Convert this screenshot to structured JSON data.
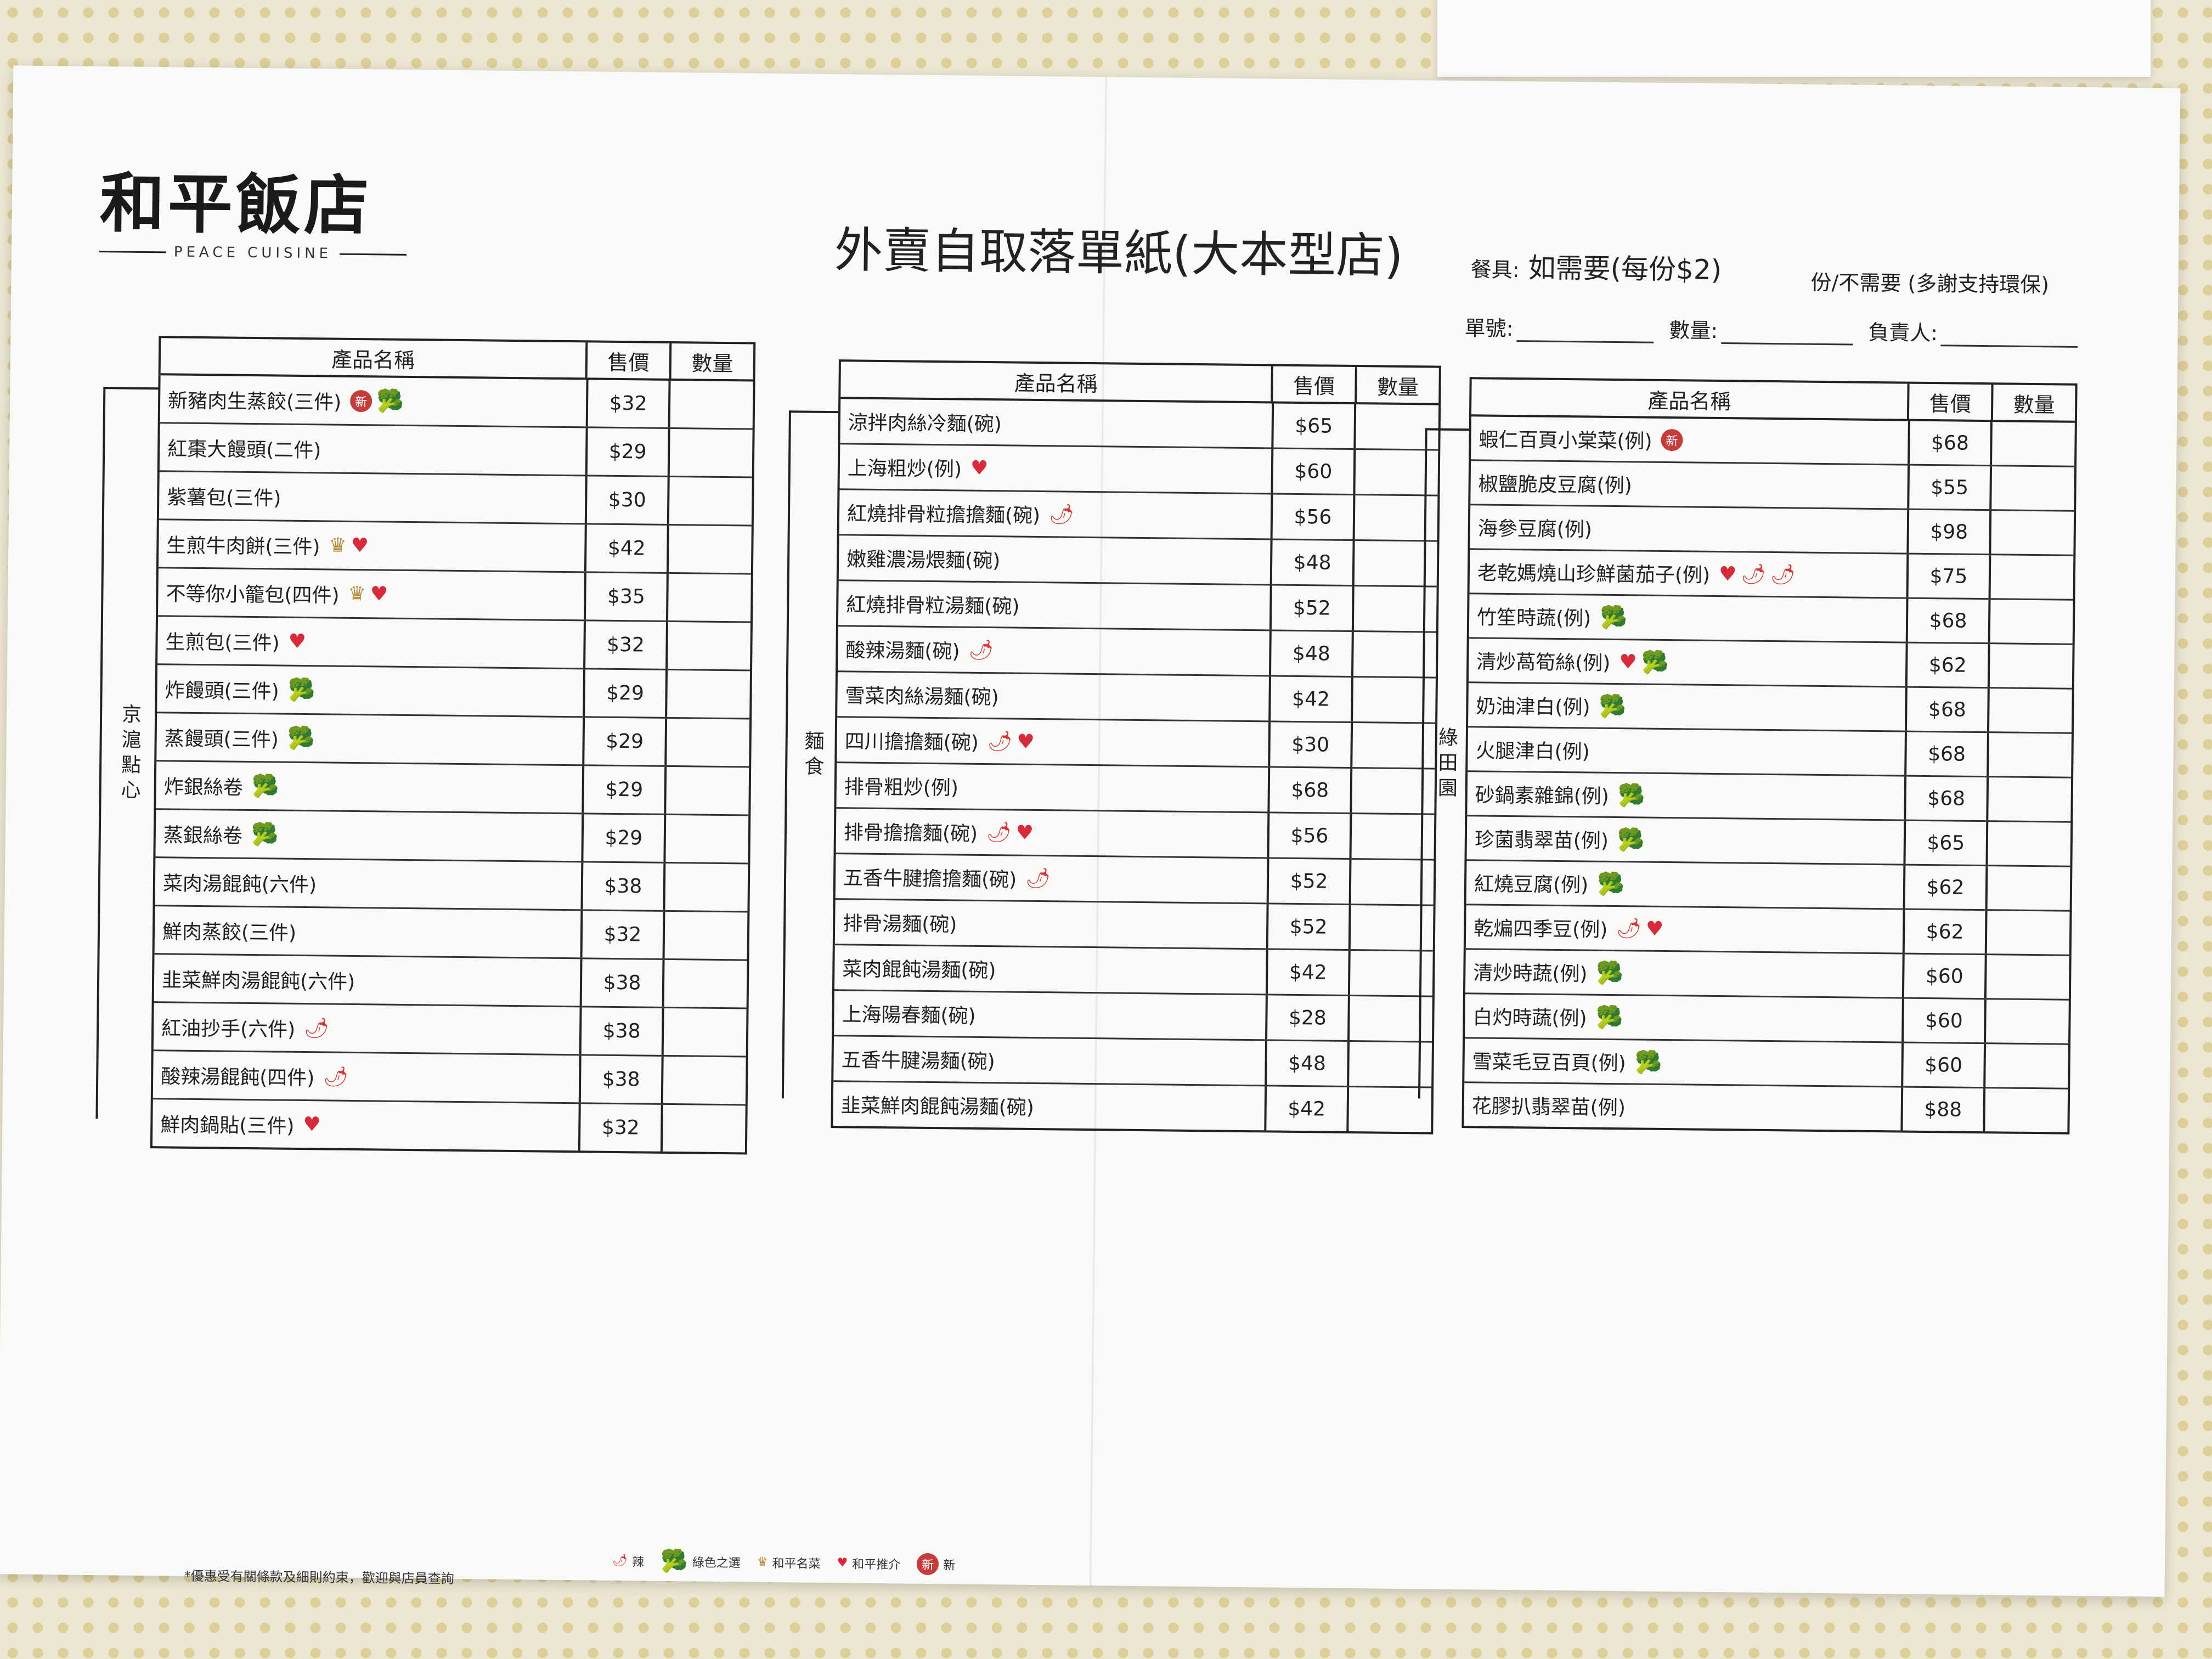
{
  "brand": {
    "name": "和平飯店",
    "sub": "PEACE CUISINE"
  },
  "title": "外賣自取落單紙(大本型店)",
  "utensil": {
    "label": "餐具:",
    "need": "如需要(每份$2)",
    "noneed": "份/不需要 (多謝支持環保)"
  },
  "fields": {
    "order_no": "單號:",
    "qty": "數量:",
    "person": "負責人:"
  },
  "headers": {
    "name": "產品名稱",
    "price": "售價",
    "qty": "數量"
  },
  "sections": [
    {
      "label": "京滬點心",
      "items": [
        {
          "name": "新豬肉生蒸餃(三件)",
          "price": "$32",
          "icons": [
            "new",
            "veg"
          ]
        },
        {
          "name": "紅棗大饅頭(二件)",
          "price": "$29",
          "icons": []
        },
        {
          "name": "紫薯包(三件)",
          "price": "$30",
          "icons": []
        },
        {
          "name": "生煎牛肉餅(三件)",
          "price": "$42",
          "icons": [
            "crown",
            "heart"
          ]
        },
        {
          "name": "不等你小籠包(四件)",
          "price": "$35",
          "icons": [
            "crown",
            "heart"
          ]
        },
        {
          "name": "生煎包(三件)",
          "price": "$32",
          "icons": [
            "heart"
          ]
        },
        {
          "name": "炸饅頭(三件)",
          "price": "$29",
          "icons": [
            "veg"
          ]
        },
        {
          "name": "蒸饅頭(三件)",
          "price": "$29",
          "icons": [
            "veg"
          ]
        },
        {
          "name": "炸銀絲卷",
          "price": "$29",
          "icons": [
            "veg"
          ]
        },
        {
          "name": "蒸銀絲卷",
          "price": "$29",
          "icons": [
            "veg"
          ]
        },
        {
          "name": "菜肉湯餛飩(六件)",
          "price": "$38",
          "icons": []
        },
        {
          "name": "鮮肉蒸餃(三件)",
          "price": "$32",
          "icons": []
        },
        {
          "name": "韭菜鮮肉湯餛飩(六件)",
          "price": "$38",
          "icons": []
        },
        {
          "name": "紅油抄手(六件)",
          "price": "$38",
          "icons": [
            "chili"
          ]
        },
        {
          "name": "酸辣湯餛飩(四件)",
          "price": "$38",
          "icons": [
            "chili"
          ]
        },
        {
          "name": "鮮肉鍋貼(三件)",
          "price": "$32",
          "icons": [
            "heart"
          ]
        }
      ]
    },
    {
      "label": "麵食",
      "items": [
        {
          "name": "涼拌肉絲冷麵(碗)",
          "price": "$65",
          "icons": []
        },
        {
          "name": "上海粗炒(例)",
          "price": "$60",
          "icons": [
            "heart"
          ]
        },
        {
          "name": "紅燒排骨粒擔擔麵(碗)",
          "price": "$56",
          "icons": [
            "chili"
          ]
        },
        {
          "name": "嫩雞濃湯煨麵(碗)",
          "price": "$48",
          "icons": []
        },
        {
          "name": "紅燒排骨粒湯麵(碗)",
          "price": "$52",
          "icons": []
        },
        {
          "name": "酸辣湯麵(碗)",
          "price": "$48",
          "icons": [
            "chili"
          ]
        },
        {
          "name": "雪菜肉絲湯麵(碗)",
          "price": "$42",
          "icons": []
        },
        {
          "name": "四川擔擔麵(碗)",
          "price": "$30",
          "icons": [
            "chili",
            "heart"
          ]
        },
        {
          "name": "排骨粗炒(例)",
          "price": "$68",
          "icons": []
        },
        {
          "name": "排骨擔擔麵(碗)",
          "price": "$56",
          "icons": [
            "chili",
            "heart"
          ]
        },
        {
          "name": "五香牛腱擔擔麵(碗)",
          "price": "$52",
          "icons": [
            "chili"
          ]
        },
        {
          "name": "排骨湯麵(碗)",
          "price": "$52",
          "icons": []
        },
        {
          "name": "菜肉餛飩湯麵(碗)",
          "price": "$42",
          "icons": []
        },
        {
          "name": "上海陽春麵(碗)",
          "price": "$28",
          "icons": []
        },
        {
          "name": "五香牛腱湯麵(碗)",
          "price": "$48",
          "icons": []
        },
        {
          "name": "韭菜鮮肉餛飩湯麵(碗)",
          "price": "$42",
          "icons": []
        }
      ]
    },
    {
      "label": "綠田園",
      "items": [
        {
          "name": "蝦仁百頁小棠菜(例)",
          "price": "$68",
          "icons": [
            "new"
          ]
        },
        {
          "name": "椒鹽脆皮豆腐(例)",
          "price": "$55",
          "icons": []
        },
        {
          "name": "海參豆腐(例)",
          "price": "$98",
          "icons": []
        },
        {
          "name": "老乾媽燒山珍鮮菌茄子(例)",
          "price": "$75",
          "icons": [
            "heart",
            "chili",
            "chili"
          ]
        },
        {
          "name": "竹笙時蔬(例)",
          "price": "$68",
          "icons": [
            "veg"
          ]
        },
        {
          "name": "清炒萵筍絲(例)",
          "price": "$62",
          "icons": [
            "heart",
            "veg"
          ]
        },
        {
          "name": "奶油津白(例)",
          "price": "$68",
          "icons": [
            "veg"
          ]
        },
        {
          "name": "火腿津白(例)",
          "price": "$68",
          "icons": []
        },
        {
          "name": "砂鍋素雜錦(例)",
          "price": "$68",
          "icons": [
            "veg"
          ]
        },
        {
          "name": "珍菌翡翠苗(例)",
          "price": "$65",
          "icons": [
            "veg"
          ]
        },
        {
          "name": "紅燒豆腐(例)",
          "price": "$62",
          "icons": [
            "veg"
          ]
        },
        {
          "name": "乾煸四季豆(例)",
          "price": "$62",
          "icons": [
            "chili",
            "heart"
          ]
        },
        {
          "name": "清炒時蔬(例)",
          "price": "$60",
          "icons": [
            "veg"
          ]
        },
        {
          "name": "白灼時蔬(例)",
          "price": "$60",
          "icons": [
            "veg"
          ]
        },
        {
          "name": "雪菜毛豆百頁(例)",
          "price": "$60",
          "icons": [
            "veg"
          ]
        },
        {
          "name": "花膠扒翡翠苗(例)",
          "price": "$88",
          "icons": []
        }
      ]
    }
  ],
  "legend": [
    {
      "icon": "chili",
      "label": "辣"
    },
    {
      "icon": "veg",
      "label": "綠色之選"
    },
    {
      "icon": "crown",
      "label": "和平名菜"
    },
    {
      "icon": "heart",
      "label": "和平推介"
    },
    {
      "icon": "new",
      "label": "新"
    }
  ],
  "footnote": "*優惠受有關條款及細則約束，歡迎與店員查詢"
}
